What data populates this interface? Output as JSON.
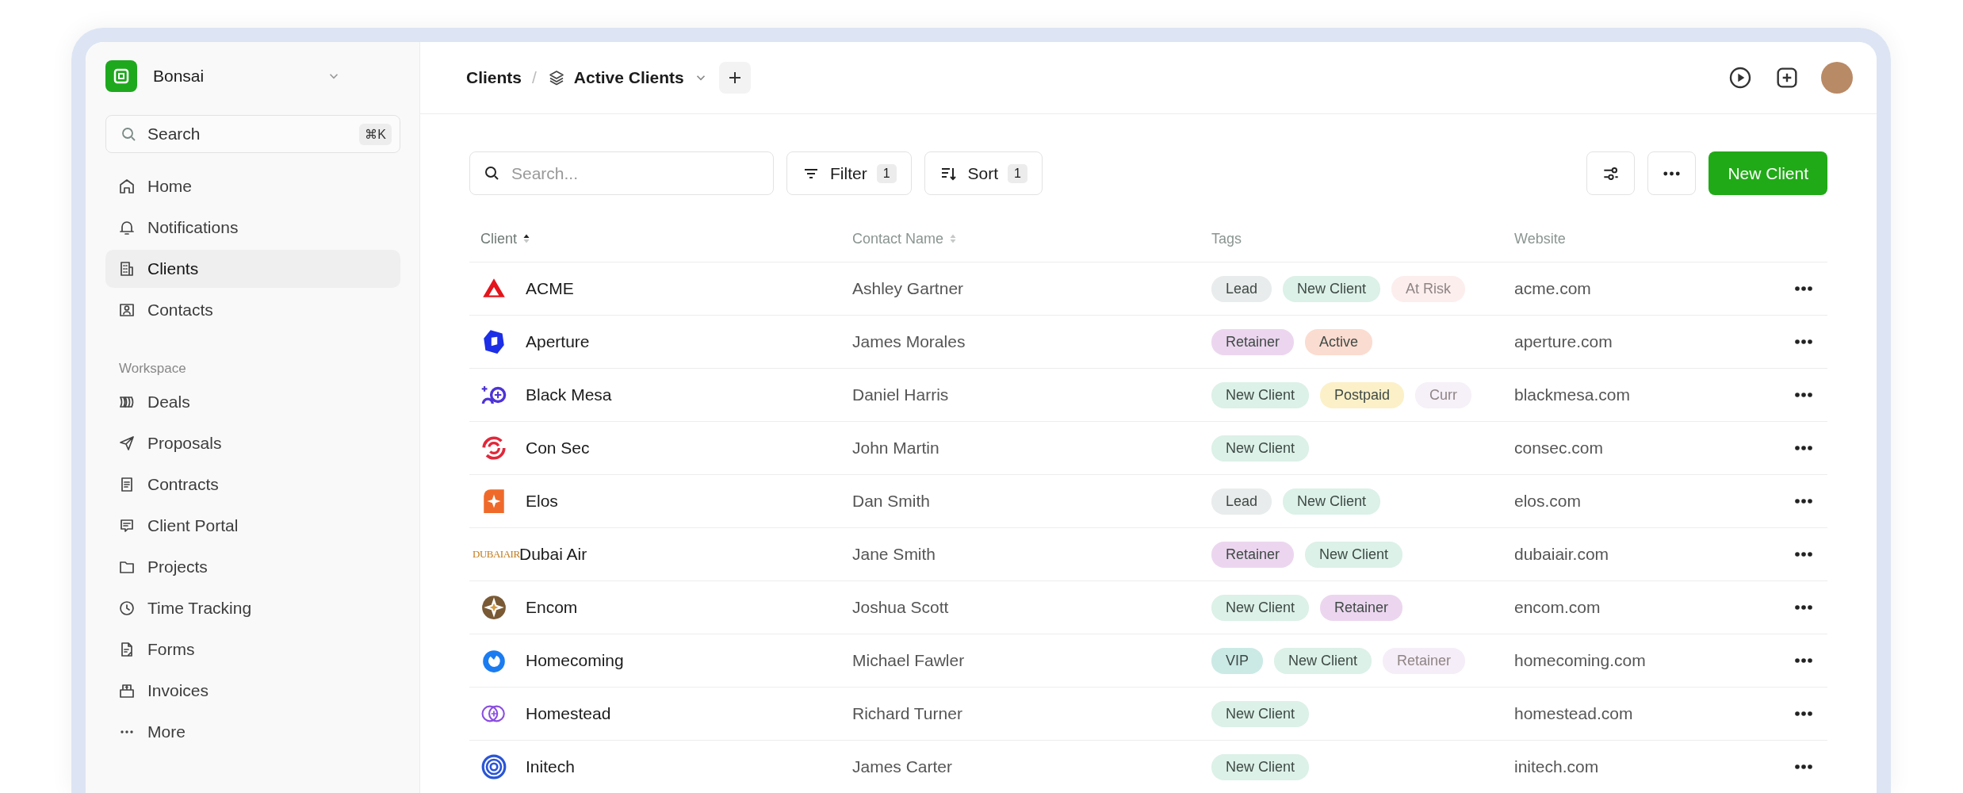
{
  "workspace": {
    "name": "Bonsai"
  },
  "search": {
    "placeholder": "Search",
    "shortcut": "⌘K"
  },
  "nav": [
    {
      "label": "Home",
      "selected": false
    },
    {
      "label": "Notifications",
      "selected": false
    },
    {
      "label": "Clients",
      "selected": true
    },
    {
      "label": "Contacts",
      "selected": false
    }
  ],
  "workspace_section": {
    "heading": "Workspace",
    "items": [
      {
        "label": "Deals",
        "selected": false
      },
      {
        "label": "Proposals",
        "selected": false
      },
      {
        "label": "Contracts",
        "selected": false
      },
      {
        "label": "Client Portal",
        "selected": false
      },
      {
        "label": "Projects",
        "selected": false
      },
      {
        "label": "Time Tracking",
        "selected": false
      },
      {
        "label": "Forms",
        "selected": false
      },
      {
        "label": "Invoices",
        "selected": false
      },
      {
        "label": "More",
        "selected": false
      }
    ]
  },
  "breadcrumb": {
    "root": "Clients",
    "separator": "/",
    "view": "Active Clients"
  },
  "toolbar": {
    "search_placeholder": "Search...",
    "filter": {
      "label": "Filter",
      "count": "1"
    },
    "sort": {
      "label": "Sort",
      "count": "1"
    },
    "primary_button": "New Client"
  },
  "table": {
    "columns": [
      {
        "label": "Client",
        "sortable": true,
        "sorted": true
      },
      {
        "label": "Contact Name",
        "sortable": true,
        "sorted": false
      },
      {
        "label": "Tags"
      },
      {
        "label": "Website"
      }
    ],
    "rows": [
      {
        "client": "ACME",
        "contact": "Ashley Gartner",
        "website": "acme.com",
        "tags": [
          {
            "label": "Lead",
            "color": "#e9ecec",
            "faded": false
          },
          {
            "label": "New Client",
            "color": "#dcf1e8",
            "faded": false
          },
          {
            "label": "At Risk",
            "color": "#fdeeee",
            "faded": true
          }
        ]
      },
      {
        "client": "Aperture",
        "contact": "James Morales",
        "website": "aperture.com",
        "tags": [
          {
            "label": "Retainer",
            "color": "#ecd6ef",
            "faded": false
          },
          {
            "label": "Active",
            "color": "#fbdcd0",
            "faded": false
          }
        ]
      },
      {
        "client": "Black Mesa",
        "contact": "Daniel Harris",
        "website": "blackmesa.com",
        "tags": [
          {
            "label": "New Client",
            "color": "#dcf1e8",
            "faded": false
          },
          {
            "label": "Postpaid",
            "color": "#fcf0c8",
            "faded": false
          },
          {
            "label": "Curr",
            "color": "#f6f0f8",
            "faded": true
          }
        ]
      },
      {
        "client": "Con Sec",
        "contact": "John Martin",
        "website": "consec.com",
        "tags": [
          {
            "label": "New Client",
            "color": "#dcf1e8",
            "faded": false
          }
        ]
      },
      {
        "client": "Elos",
        "contact": "Dan Smith",
        "website": "elos.com",
        "tags": [
          {
            "label": "Lead",
            "color": "#e9ecec",
            "faded": false
          },
          {
            "label": "New Client",
            "color": "#dcf1e8",
            "faded": false
          }
        ]
      },
      {
        "client": "Dubai Air",
        "logo_text": "DUBAIAIR",
        "contact": "Jane Smith",
        "website": "dubaiair.com",
        "tags": [
          {
            "label": "Retainer",
            "color": "#ecd6ef",
            "faded": false
          },
          {
            "label": "New Client",
            "color": "#dcf1e8",
            "faded": false
          }
        ]
      },
      {
        "client": "Encom",
        "contact": "Joshua Scott",
        "website": "encom.com",
        "tags": [
          {
            "label": "New Client",
            "color": "#dcf1e8",
            "faded": false
          },
          {
            "label": "Retainer",
            "color": "#ecd6ef",
            "faded": false
          }
        ]
      },
      {
        "client": "Homecoming",
        "contact": "Michael Fawler",
        "website": "homecoming.com",
        "tags": [
          {
            "label": "VIP",
            "color": "#cbeae6",
            "faded": false
          },
          {
            "label": "New Client",
            "color": "#dcf1e8",
            "faded": false
          },
          {
            "label": "Retainer",
            "color": "#f5edf7",
            "faded": true
          }
        ]
      },
      {
        "client": "Homestead",
        "contact": "Richard Turner",
        "website": "homestead.com",
        "tags": [
          {
            "label": "New Client",
            "color": "#dcf1e8",
            "faded": false
          }
        ]
      },
      {
        "client": "Initech",
        "contact": "James Carter",
        "website": "initech.com",
        "tags": [
          {
            "label": "New Client",
            "color": "#dcf1e8",
            "faded": false
          }
        ]
      }
    ]
  }
}
